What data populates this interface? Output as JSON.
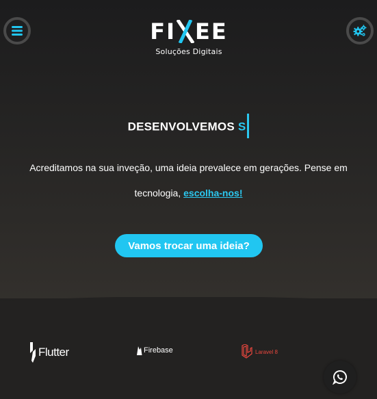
{
  "colors": {
    "accent": "#21c6f1",
    "background_dark": "#1c1c1d",
    "background_bottom": "#232221",
    "laravel_red": "#e9473e"
  },
  "header": {
    "menu_icon": "bars-icon",
    "settings_icon": "gears-icon",
    "logo": {
      "word_left": "FI",
      "word_right": "EE",
      "tagline": "Soluções Digitais"
    }
  },
  "hero": {
    "headline_static": "DESENVOLVEMOS",
    "headline_typed": "S",
    "lead_text": "Acreditamos na sua inveção, uma ideia prevalece em gerações. Pense em tecnologia,",
    "lead_link": "escolha-nos!",
    "cta_label": "Vamos trocar uma ideia?"
  },
  "partners": [
    {
      "name": "Flutter",
      "icon": "flutter-logo-icon"
    },
    {
      "name": "Firebase",
      "icon": "firebase-logo-icon"
    },
    {
      "name": "Laravel 8",
      "icon": "laravel-logo-icon"
    }
  ],
  "floating": {
    "whatsapp_icon": "whatsapp-icon"
  }
}
